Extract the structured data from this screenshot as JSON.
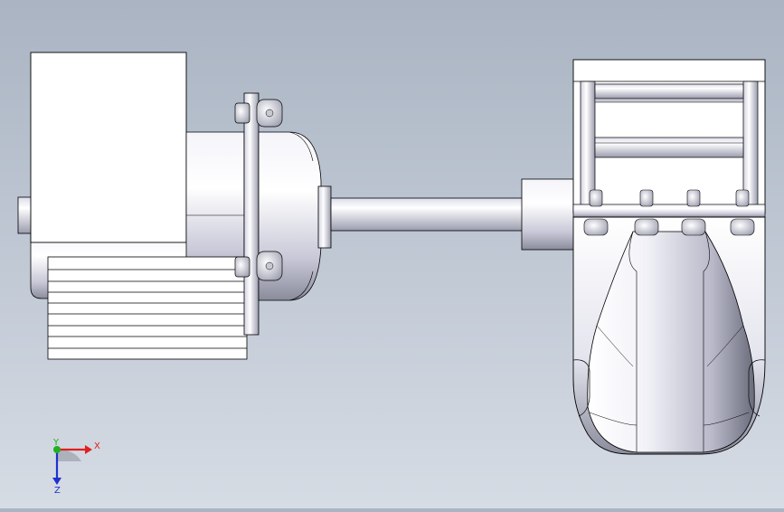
{
  "viewport": {
    "background_top": "#aab4c2",
    "background_bottom": "#d6dce4"
  },
  "model": {
    "parts": [
      "motor",
      "motor-fan-cover",
      "motor-flange",
      "shaft",
      "coupling",
      "pump-housing",
      "volute"
    ],
    "line_color": "#000000",
    "metal_light": "#ffffff",
    "metal_dark": "#7a7c8a"
  },
  "triad": {
    "x_label": "X",
    "y_label": "Y",
    "z_label": "Z",
    "x_color": "#e02020",
    "y_color": "#20b020",
    "z_color": "#2030d0"
  }
}
